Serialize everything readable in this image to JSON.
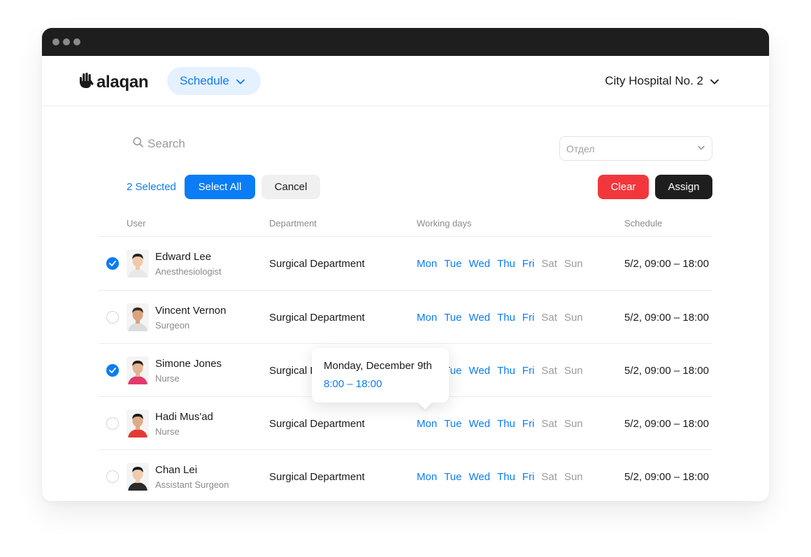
{
  "app": {
    "brand": "alaqan",
    "module": "Schedule",
    "organization": "City Hospital No. 2"
  },
  "toolbar": {
    "search_placeholder": "Search",
    "department_placeholder": "Отдел",
    "selected_count": "2 Selected",
    "select_all_label": "Select All",
    "cancel_label": "Cancel",
    "clear_label": "Clear",
    "assign_label": "Assign"
  },
  "table": {
    "columns": [
      "User",
      "Department",
      "Working days",
      "Schedule"
    ],
    "day_labels": [
      "Mon",
      "Tue",
      "Wed",
      "Thu",
      "Fri",
      "Sat",
      "Sun"
    ],
    "rows": [
      {
        "name": "Edward Lee",
        "role": "Anesthesiologist",
        "department": "Surgical Department",
        "schedule": "5/2, 09:00 – 18:00",
        "checked": true,
        "working_days": [
          true,
          true,
          true,
          true,
          true,
          false,
          false
        ]
      },
      {
        "name": "Vincent Vernon",
        "role": "Surgeon",
        "department": "Surgical Department",
        "schedule": "5/2, 09:00 – 18:00",
        "checked": false,
        "working_days": [
          true,
          true,
          true,
          true,
          true,
          false,
          false
        ]
      },
      {
        "name": "Simone Jones",
        "role": "Nurse",
        "department": "Surgical Department",
        "schedule": "5/2, 09:00 – 18:00",
        "checked": true,
        "working_days": [
          true,
          true,
          true,
          true,
          true,
          false,
          false
        ]
      },
      {
        "name": "Hadi Mus'ad",
        "role": "Nurse",
        "department": "Surgical Department",
        "schedule": "5/2, 09:00 – 18:00",
        "checked": false,
        "working_days": [
          true,
          true,
          true,
          true,
          true,
          false,
          false
        ]
      },
      {
        "name": "Chan Lei",
        "role": "Assistant Surgeon",
        "department": "Surgical Department",
        "schedule": "5/2, 09:00 – 18:00",
        "checked": false,
        "working_days": [
          true,
          true,
          true,
          true,
          true,
          false,
          false
        ]
      }
    ]
  },
  "tooltip": {
    "date": "Monday, December 9th",
    "time": "8:00 – 18:00"
  },
  "colors": {
    "accent": "#0a7cf5",
    "danger": "#f2373c",
    "dark": "#1e1e1e"
  }
}
